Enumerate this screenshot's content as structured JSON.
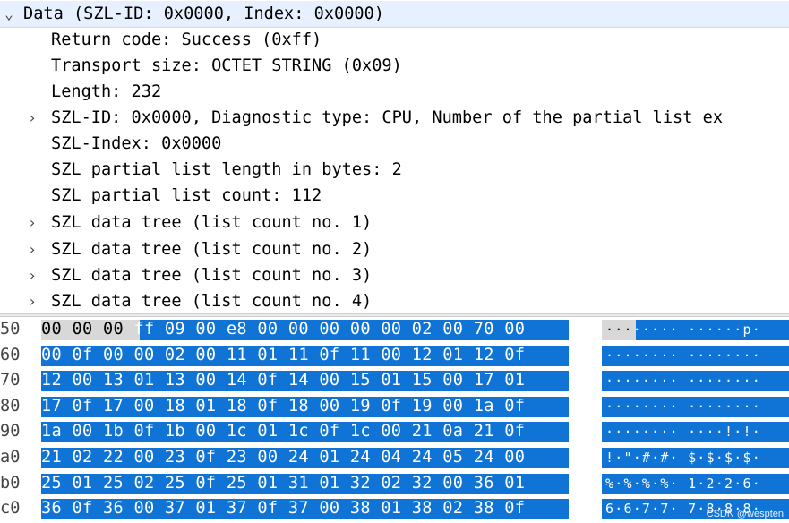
{
  "tree": [
    {
      "arrow": "⌄",
      "text": "Data (SZL-ID: 0x0000, Index: 0x0000)",
      "indent": 0,
      "expandable": true,
      "selected": true
    },
    {
      "arrow": "",
      "text": "Return code: Success (0xff)",
      "indent": 1
    },
    {
      "arrow": "",
      "text": "Transport size: OCTET STRING (0x09)",
      "indent": 1
    },
    {
      "arrow": "",
      "text": "Length: 232",
      "indent": 1
    },
    {
      "arrow": "›",
      "text": "SZL-ID: 0x0000, Diagnostic type: CPU, Number of the partial list ex",
      "indent": 1,
      "expandable": true
    },
    {
      "arrow": "",
      "text": "SZL-Index: 0x0000",
      "indent": 1
    },
    {
      "arrow": "",
      "text": "SZL partial list length in bytes: 2",
      "indent": 1
    },
    {
      "arrow": "",
      "text": "SZL partial list count: 112",
      "indent": 1
    },
    {
      "arrow": "›",
      "text": "SZL data tree (list count no. 1)",
      "indent": 1,
      "expandable": true
    },
    {
      "arrow": "›",
      "text": "SZL data tree (list count no. 2)",
      "indent": 1,
      "expandable": true
    },
    {
      "arrow": "›",
      "text": "SZL data tree (list count no. 3)",
      "indent": 1,
      "expandable": true
    },
    {
      "arrow": "›",
      "text": "SZL data tree (list count no. 4)",
      "indent": 1,
      "expandable": true
    }
  ],
  "hex": [
    {
      "offset": "50",
      "pre": "00 00 00 ",
      "hex": "ff 09 00 e8 00  00 00 00 00 02 00 70 00",
      "apre": "···",
      "ascii": "····· ······p·"
    },
    {
      "offset": "60",
      "hex": "00 0f 00 00 02 00 11 01  11 0f 11 00 12 01 12 0f",
      "ascii": "········ ········"
    },
    {
      "offset": "70",
      "hex": "12 00 13 01 13 00 14 0f  14 00 15 01 15 00 17 01",
      "ascii": "········ ········"
    },
    {
      "offset": "80",
      "hex": "17 0f 17 00 18 01 18 0f  18 00 19 0f 19 00 1a 0f",
      "ascii": "········ ········"
    },
    {
      "offset": "90",
      "hex": "1a 00 1b 0f 1b 00 1c 01  1c 0f 1c 00 21 0a 21 0f",
      "ascii": "········ ····!·!·"
    },
    {
      "offset": "a0",
      "hex": "21 02 22 00 23 0f 23 00  24 01 24 04 24 05 24 00",
      "ascii": "!·\"·#·#· $·$·$·$·"
    },
    {
      "offset": "b0",
      "hex": "25 01 25 02 25 0f 25 01  31 01 32 02 32 00 36 01",
      "ascii": "%·%·%·%· 1·2·2·6·"
    },
    {
      "offset": "c0",
      "hex": "36 0f 36 00 37 01 37 0f  37 00 38 01 38 02 38 0f",
      "ascii": "6·6·7·7· 7·8·8·8·"
    }
  ],
  "watermark": "CSDN @wespten",
  "colors": {
    "selection": "#0f74d6",
    "tree_selected": "#e6f0ff"
  }
}
